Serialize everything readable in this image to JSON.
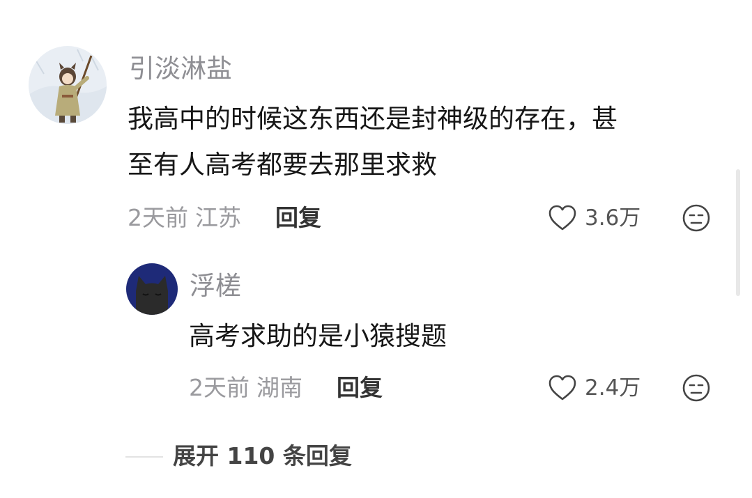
{
  "comment": {
    "username": "引淡淋盐",
    "text_line1": "我高中的时候这东西还是封神级的存在，甚",
    "text_line2": "至有人高考都要去那里求救",
    "time": "2天前",
    "location": "江苏",
    "reply_label": "回复",
    "likes": "3.6万"
  },
  "reply": {
    "username": "浮槎",
    "text": "高考求助的是小猿搜题",
    "time": "2天前",
    "location": "湖南",
    "reply_label": "回复",
    "likes": "2.4万"
  },
  "expand": {
    "label": "展开 110 条回复"
  },
  "colors": {
    "text_primary": "#161616",
    "text_secondary": "#8e8e93",
    "reply_avatar_bg": "#1e2a78"
  },
  "icons": [
    "heart-outline-icon",
    "unimpressed-face-icon"
  ]
}
